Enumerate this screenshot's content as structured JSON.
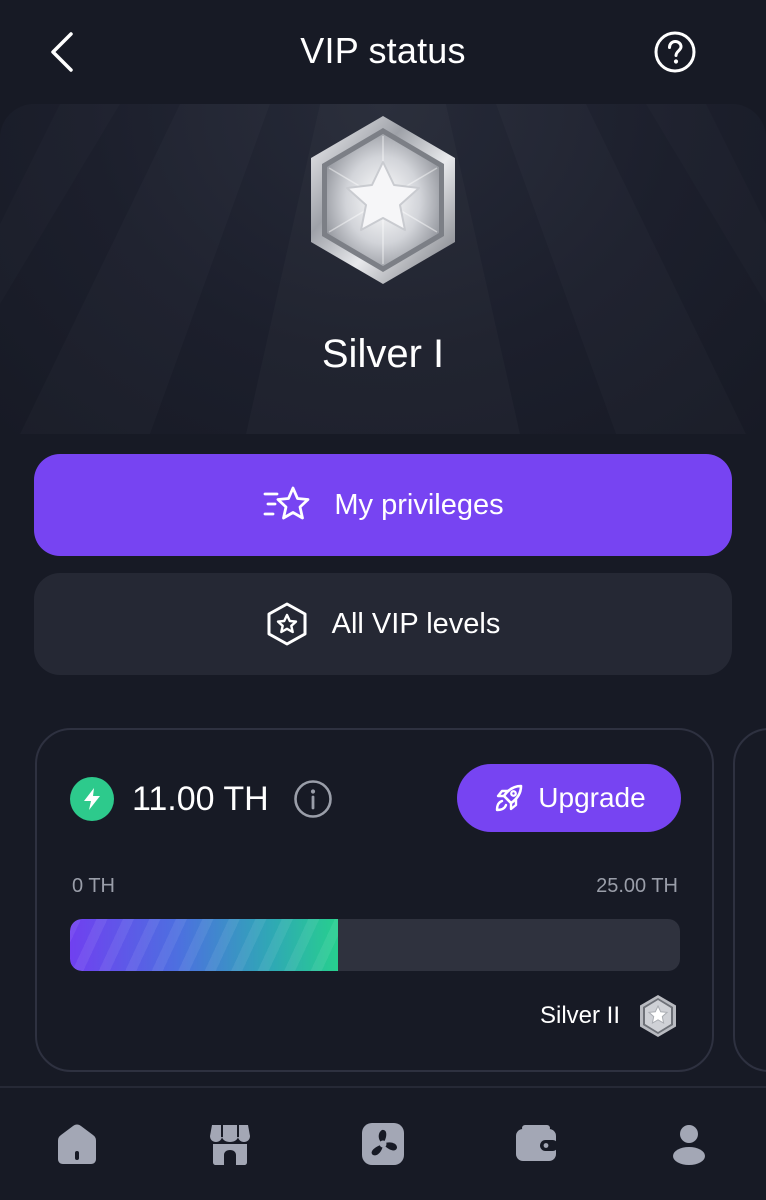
{
  "header": {
    "title": "VIP status",
    "back_icon": "chevron-left-icon",
    "help_icon": "question-circle-icon"
  },
  "hero": {
    "badge_icon": "silver-star-badge-icon",
    "level_name": "Silver I"
  },
  "actions": {
    "privileges_label": "My privileges",
    "privileges_icon": "star-speed-icon",
    "levels_label": "All VIP levels",
    "levels_icon": "hexagon-star-icon"
  },
  "progress_card": {
    "hashrate": "11.00 TH",
    "upgrade_label": "Upgrade",
    "range_min": "0 TH",
    "range_max": "25.00 TH",
    "progress_fraction": 0.44,
    "next_level": "Silver II"
  },
  "bottom_nav": {
    "items": [
      "home-icon",
      "store-icon",
      "mining-fan-icon",
      "wallet-icon",
      "profile-icon"
    ]
  },
  "colors": {
    "background": "#171a25",
    "accent": "#7744f2",
    "secondary_button": "#252834",
    "success": "#2dca8c",
    "muted_text": "#9a9ea9",
    "nav_icon": "#a3a7b5"
  }
}
